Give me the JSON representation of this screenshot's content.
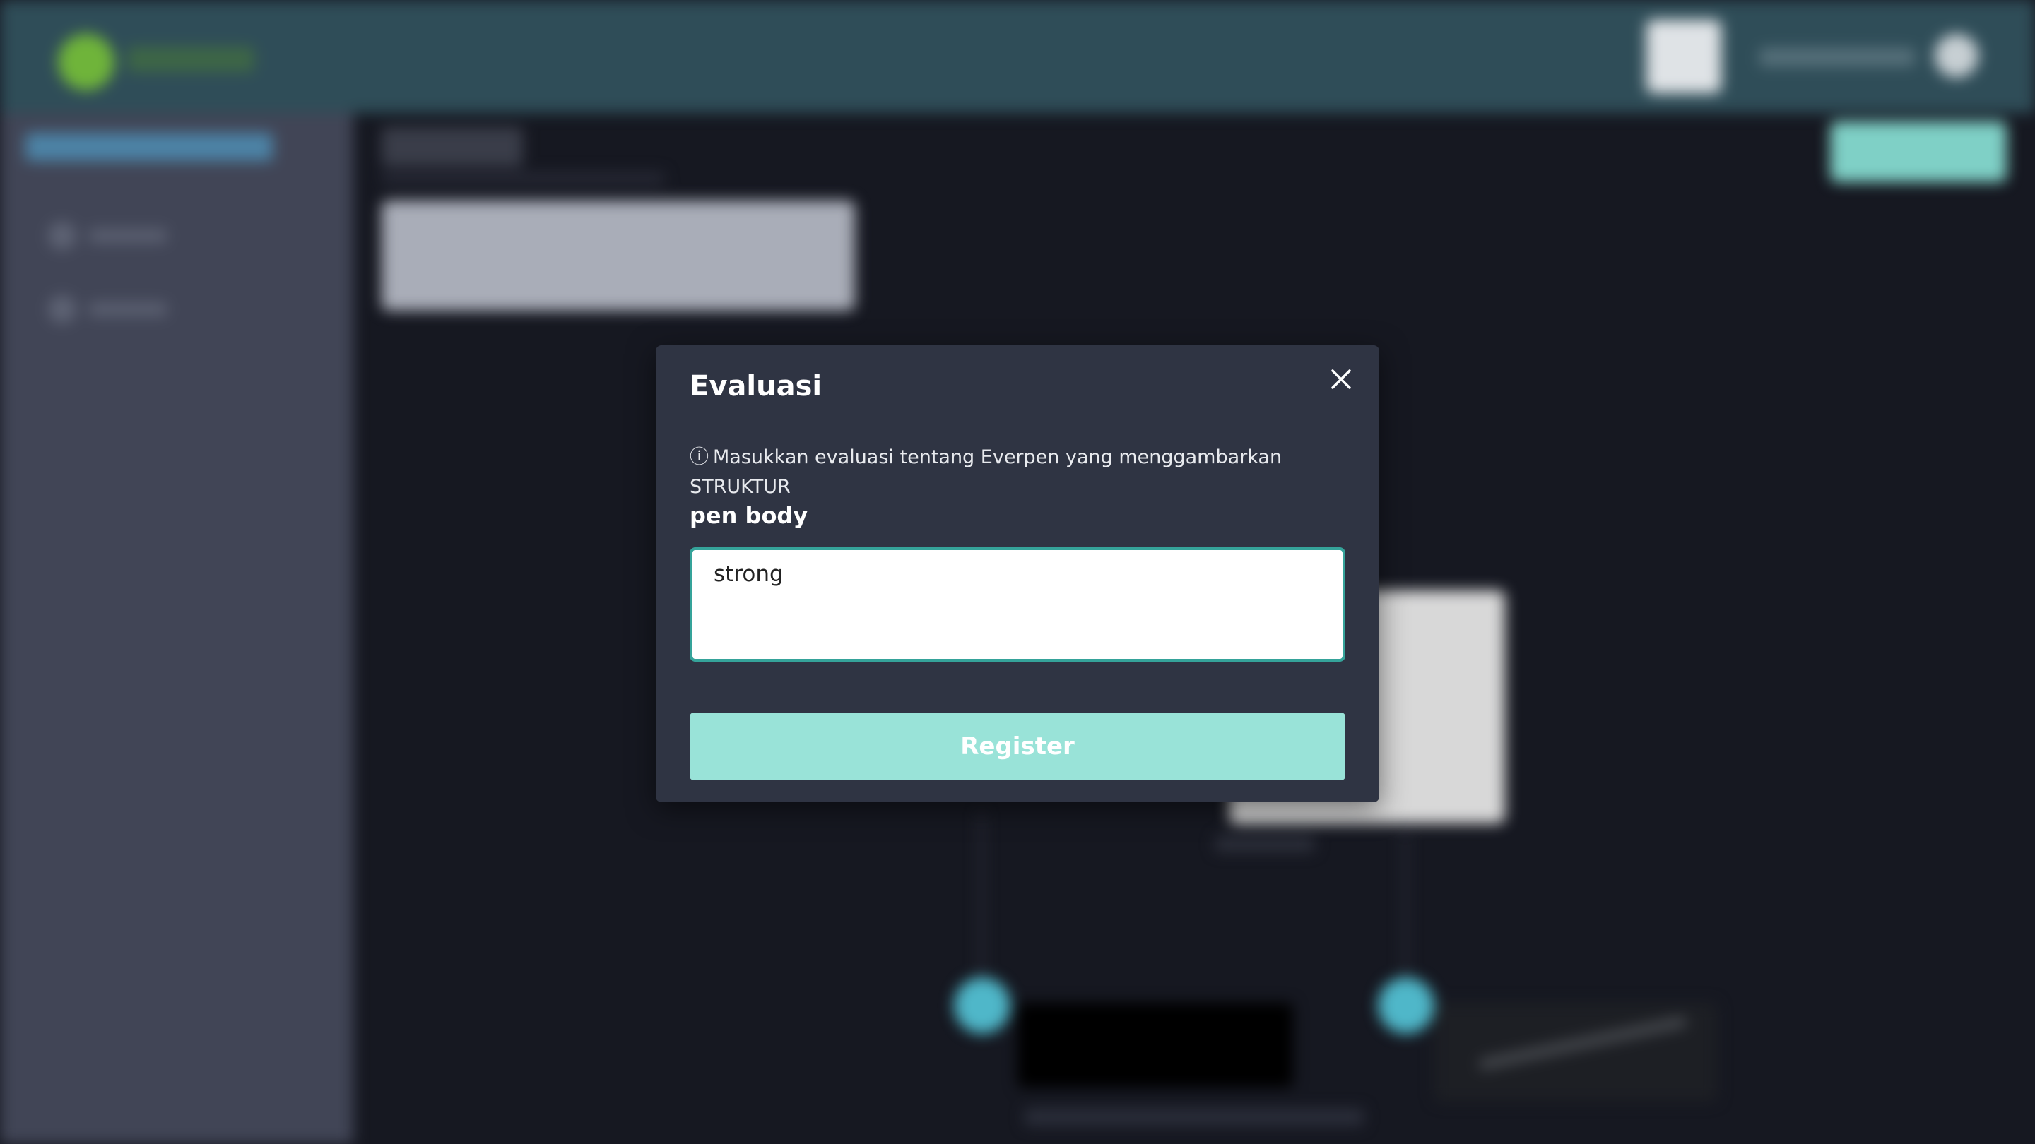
{
  "modal": {
    "title": "Evaluasi",
    "info_icon": "ⓘ",
    "info_text": "Masukkan evaluasi tentang Everpen yang menggambarkan STRUKTUR",
    "field_label": "pen body",
    "input_value": "strong",
    "submit_label": "Register",
    "close_icon": "close-icon"
  },
  "colors": {
    "topbar": "#2f4d58",
    "sidebar": "#414556",
    "page_background": "#161821",
    "modal_background": "#2f3443",
    "input_border": "#35a39a",
    "button": "#99e3d8"
  }
}
